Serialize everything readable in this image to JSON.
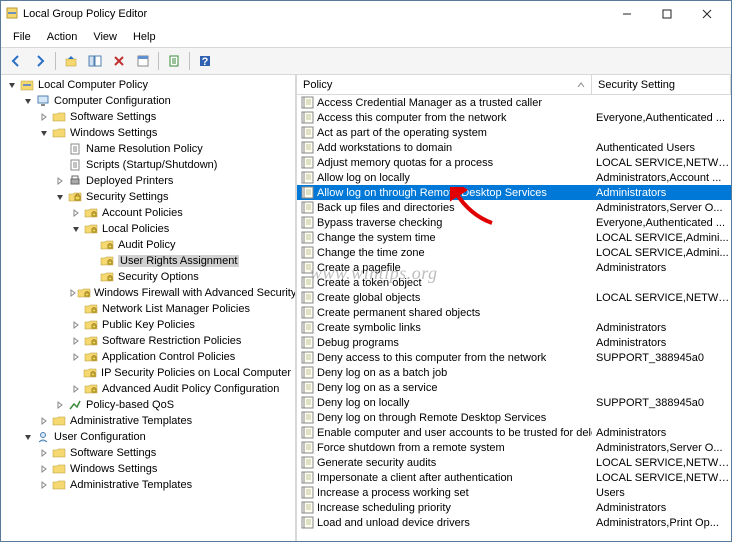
{
  "window": {
    "title": "Local Group Policy Editor"
  },
  "menu": [
    "File",
    "Action",
    "View",
    "Help"
  ],
  "tree": [
    {
      "d": 0,
      "ex": 1,
      "lbl": "Local Computer Policy",
      "ic": "root"
    },
    {
      "d": 1,
      "ex": 1,
      "lbl": "Computer Configuration",
      "ic": "comp"
    },
    {
      "d": 2,
      "ex": 0,
      "lbl": "Software Settings",
      "ic": "fold",
      "tw": 1
    },
    {
      "d": 2,
      "ex": 1,
      "lbl": "Windows Settings",
      "ic": "fold"
    },
    {
      "d": 3,
      "ex": 0,
      "lbl": "Name Resolution Policy",
      "ic": "page"
    },
    {
      "d": 3,
      "ex": 0,
      "lbl": "Scripts (Startup/Shutdown)",
      "ic": "page"
    },
    {
      "d": 3,
      "ex": 0,
      "lbl": "Deployed Printers",
      "ic": "prn",
      "tw": 1
    },
    {
      "d": 3,
      "ex": 1,
      "lbl": "Security Settings",
      "ic": "sec"
    },
    {
      "d": 4,
      "ex": 0,
      "lbl": "Account Policies",
      "ic": "secf",
      "tw": 1
    },
    {
      "d": 4,
      "ex": 1,
      "lbl": "Local Policies",
      "ic": "secf"
    },
    {
      "d": 5,
      "ex": 0,
      "lbl": "Audit Policy",
      "ic": "secf"
    },
    {
      "d": 5,
      "ex": 0,
      "lbl": "User Rights Assignment",
      "ic": "secf",
      "sel": 1
    },
    {
      "d": 5,
      "ex": 0,
      "lbl": "Security Options",
      "ic": "secf"
    },
    {
      "d": 4,
      "ex": 0,
      "lbl": "Windows Firewall with Advanced Security",
      "ic": "secf",
      "tw": 1
    },
    {
      "d": 4,
      "ex": 0,
      "lbl": "Network List Manager Policies",
      "ic": "secf"
    },
    {
      "d": 4,
      "ex": 0,
      "lbl": "Public Key Policies",
      "ic": "secf",
      "tw": 1
    },
    {
      "d": 4,
      "ex": 0,
      "lbl": "Software Restriction Policies",
      "ic": "secf",
      "tw": 1
    },
    {
      "d": 4,
      "ex": 0,
      "lbl": "Application Control Policies",
      "ic": "secf",
      "tw": 1
    },
    {
      "d": 4,
      "ex": 0,
      "lbl": "IP Security Policies on Local Computer",
      "ic": "secf"
    },
    {
      "d": 4,
      "ex": 0,
      "lbl": "Advanced Audit Policy Configuration",
      "ic": "secf",
      "tw": 1
    },
    {
      "d": 3,
      "ex": 0,
      "lbl": "Policy-based QoS",
      "ic": "qos",
      "tw": 1
    },
    {
      "d": 2,
      "ex": 0,
      "lbl": "Administrative Templates",
      "ic": "fold",
      "tw": 1
    },
    {
      "d": 1,
      "ex": 1,
      "lbl": "User Configuration",
      "ic": "user"
    },
    {
      "d": 2,
      "ex": 0,
      "lbl": "Software Settings",
      "ic": "fold",
      "tw": 1
    },
    {
      "d": 2,
      "ex": 0,
      "lbl": "Windows Settings",
      "ic": "fold",
      "tw": 1
    },
    {
      "d": 2,
      "ex": 0,
      "lbl": "Administrative Templates",
      "ic": "fold",
      "tw": 1
    }
  ],
  "columns": [
    "Policy",
    "Security Setting"
  ],
  "policies": [
    {
      "p": "Access Credential Manager as a trusted caller",
      "s": ""
    },
    {
      "p": "Access this computer from the network",
      "s": "Everyone,Authenticated ..."
    },
    {
      "p": "Act as part of the operating system",
      "s": ""
    },
    {
      "p": "Add workstations to domain",
      "s": "Authenticated Users"
    },
    {
      "p": "Adjust memory quotas for a process",
      "s": "LOCAL SERVICE,NETWO..."
    },
    {
      "p": "Allow log on locally",
      "s": "Administrators,Account ..."
    },
    {
      "p": "Allow log on through Remote Desktop Services",
      "s": "Administrators",
      "sel": 1
    },
    {
      "p": "Back up files and directories",
      "s": "Administrators,Server O..."
    },
    {
      "p": "Bypass traverse checking",
      "s": "Everyone,Authenticated ..."
    },
    {
      "p": "Change the system time",
      "s": "LOCAL SERVICE,Admini..."
    },
    {
      "p": "Change the time zone",
      "s": "LOCAL SERVICE,Admini..."
    },
    {
      "p": "Create a pagefile",
      "s": "Administrators"
    },
    {
      "p": "Create a token object",
      "s": ""
    },
    {
      "p": "Create global objects",
      "s": "LOCAL SERVICE,NETWO..."
    },
    {
      "p": "Create permanent shared objects",
      "s": ""
    },
    {
      "p": "Create symbolic links",
      "s": "Administrators"
    },
    {
      "p": "Debug programs",
      "s": "Administrators"
    },
    {
      "p": "Deny access to this computer from the network",
      "s": "SUPPORT_388945a0"
    },
    {
      "p": "Deny log on as a batch job",
      "s": ""
    },
    {
      "p": "Deny log on as a service",
      "s": ""
    },
    {
      "p": "Deny log on locally",
      "s": "SUPPORT_388945a0"
    },
    {
      "p": "Deny log on through Remote Desktop Services",
      "s": ""
    },
    {
      "p": "Enable computer and user accounts to be trusted for delega...",
      "s": "Administrators"
    },
    {
      "p": "Force shutdown from a remote system",
      "s": "Administrators,Server O..."
    },
    {
      "p": "Generate security audits",
      "s": "LOCAL SERVICE,NETWO..."
    },
    {
      "p": "Impersonate a client after authentication",
      "s": "LOCAL SERVICE,NETWO..."
    },
    {
      "p": "Increase a process working set",
      "s": "Users"
    },
    {
      "p": "Increase scheduling priority",
      "s": "Administrators"
    },
    {
      "p": "Load and unload device drivers",
      "s": "Administrators,Print Op..."
    }
  ],
  "watermark": "www.wintips.org"
}
